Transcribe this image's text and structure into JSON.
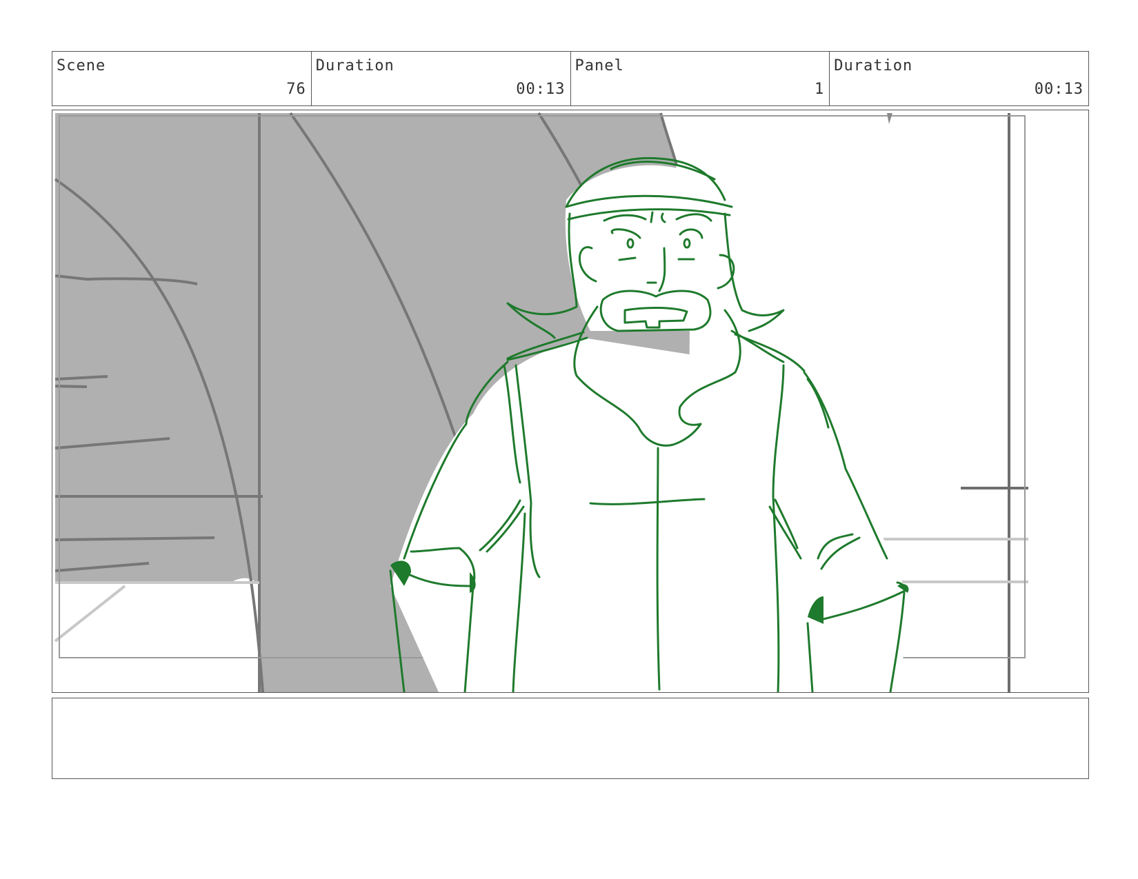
{
  "header": {
    "scene": {
      "label": "Scene",
      "value": "76"
    },
    "scene_duration": {
      "label": "Duration",
      "value": "00:13"
    },
    "panel": {
      "label": "Panel",
      "value": "1"
    },
    "panel_duration": {
      "label": "Duration",
      "value": "00:13"
    }
  },
  "panel": {
    "colors": {
      "sketch_green": "#1e7a2c",
      "background_gray": "#b0b0b0",
      "line_gray": "#777777",
      "light_gray": "#c8c8c8"
    }
  },
  "caption": {
    "text": ""
  }
}
